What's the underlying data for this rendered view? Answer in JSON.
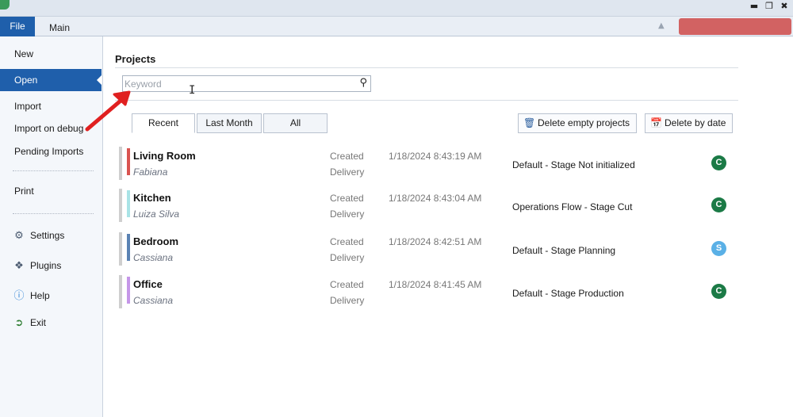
{
  "ribbon": {
    "file_label": "File",
    "main_label": "Main"
  },
  "sidebar": {
    "items": [
      {
        "label": "New",
        "icon": ""
      },
      {
        "label": "Open",
        "icon": ""
      },
      {
        "label": "Import",
        "icon": ""
      },
      {
        "label": "Import on debug",
        "icon": ""
      },
      {
        "label": "Pending Imports",
        "icon": ""
      },
      {
        "label": "Print",
        "icon": ""
      },
      {
        "label": "Settings",
        "icon": "gear-icon"
      },
      {
        "label": "Plugins",
        "icon": "puzzle-icon"
      },
      {
        "label": "Help",
        "icon": "help-icon"
      },
      {
        "label": "Exit",
        "icon": "exit-icon"
      }
    ]
  },
  "projects": {
    "title": "Projects",
    "search": {
      "placeholder": "Keyword",
      "value": ""
    },
    "tabs": [
      "Recent",
      "Last Month",
      "All"
    ],
    "actions": {
      "delete_empty": "Delete empty projects",
      "delete_by_date": "Delete by date"
    },
    "rows": [
      {
        "name": "Living Room",
        "owner": "Fabiana",
        "created_label": "Created",
        "delivery_label": "Delivery",
        "created": "1/18/2024 8:43:19 AM",
        "flow": "Default - Stage Not initialized",
        "status": "C",
        "color": "#d9534f",
        "status_color": "#1b7a46"
      },
      {
        "name": "Kitchen",
        "owner": "Luiza Silva",
        "created_label": "Created",
        "delivery_label": "Delivery",
        "created": "1/18/2024 8:43:04 AM",
        "flow": "Operations Flow - Stage Cut",
        "status": "C",
        "color": "#a9e3e6",
        "status_color": "#1b7a46"
      },
      {
        "name": "Bedroom",
        "owner": "Cassiana",
        "created_label": "Created",
        "delivery_label": "Delivery",
        "created": "1/18/2024 8:42:51 AM",
        "flow": "Default - Stage Planning",
        "status": "S",
        "color": "#5a82b3",
        "status_color": "#5ab0e6"
      },
      {
        "name": "Office",
        "owner": "Cassiana",
        "created_label": "Created",
        "delivery_label": "Delivery",
        "created": "1/18/2024 8:41:45 AM",
        "flow": "Default - Stage Production",
        "status": "C",
        "color": "#c596e8",
        "status_color": "#1b7a46"
      }
    ]
  },
  "colors": {
    "accent": "#1f5fab",
    "annotation": "#e02020"
  }
}
